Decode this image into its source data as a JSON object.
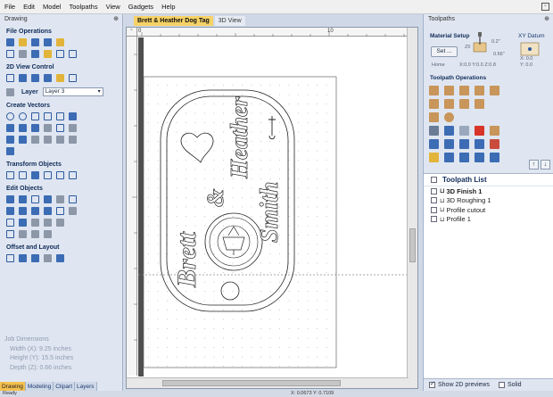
{
  "menu": {
    "items": [
      "File",
      "Edit",
      "Model",
      "Toolpaths",
      "View",
      "Gadgets",
      "Help"
    ]
  },
  "left_panel": {
    "title": "Drawing",
    "sections": {
      "file_operations": "File Operations",
      "view_control": "2D View Control",
      "create_vectors": "Create Vectors",
      "transform_objects": "Transform Objects",
      "edit_objects": "Edit Objects",
      "offset_layout": "Offset and Layout"
    },
    "layer_label": "Layer",
    "layer_value": "Layer 3",
    "job_dimensions": {
      "title": "Job Dimensions",
      "width": "Width  (X): 9.25 inches",
      "height": "Height (Y): 15.5 inches",
      "depth": "Depth  (Z): 0.66 inches"
    },
    "tabs": [
      "Drawing",
      "Modeling",
      "Clipart",
      "Layers"
    ]
  },
  "canvas": {
    "tabs": [
      "Brett & Heather Dog Tag",
      "3D View"
    ],
    "ruler_marks": [
      "0",
      "10"
    ],
    "design_text": {
      "name1": "Brett",
      "amp": "&",
      "name2": "Heather",
      "name3": "Smith"
    }
  },
  "right_panel": {
    "title": "Toolpaths",
    "material_setup": "Material Setup",
    "set_button": "Set ...",
    "home_label": "Home",
    "home_value": "X:0.0 Y:0.0 Z:0.8",
    "z_top": "0.2\"",
    "z_bottom": "0.66\"",
    "z_label": "Z0",
    "xy_datum": "XY Datum",
    "datum_x": "X: 0.0",
    "datum_y": "Y: 0.0",
    "toolpath_operations": "Toolpath Operations",
    "toolpath_list_title": "Toolpath List",
    "toolpaths": [
      {
        "name": "3D Finish 1",
        "bold": true
      },
      {
        "name": "3D Roughing 1",
        "bold": false
      },
      {
        "name": "Profile cutout",
        "bold": false
      },
      {
        "name": "Profile 1",
        "bold": false
      }
    ],
    "show_2d_previews": "Show 2D previews",
    "solid": "Solid"
  },
  "status": {
    "left": "Ready",
    "coords": "X: 0.0673 Y: 0.7109"
  }
}
